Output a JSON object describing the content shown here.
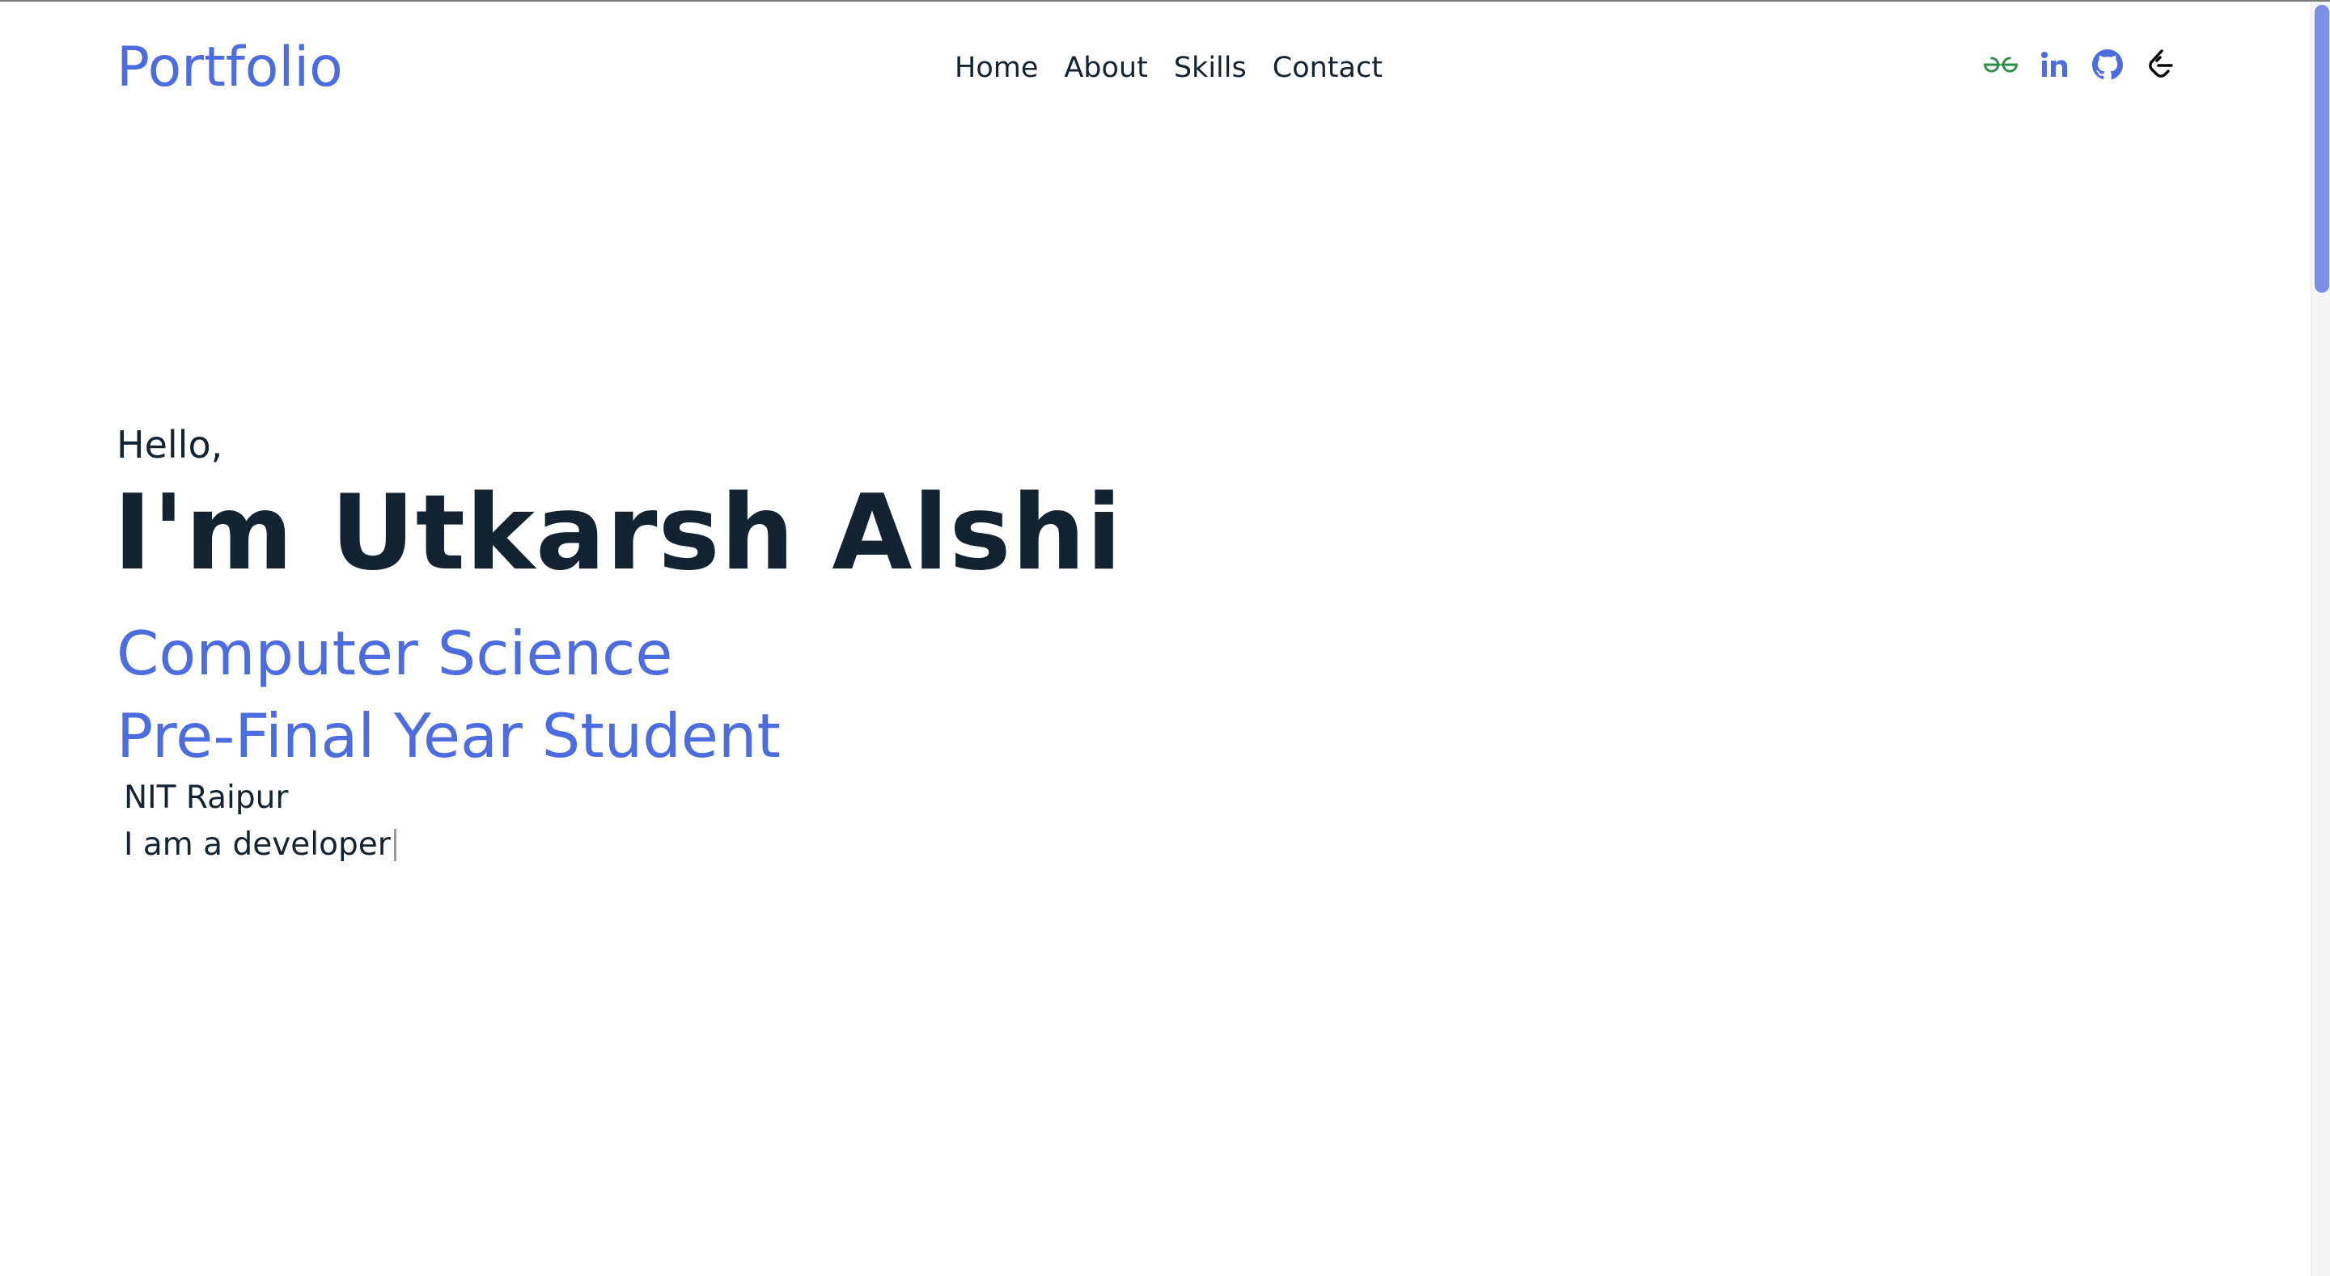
{
  "header": {
    "logo": "Portfolio",
    "nav": [
      {
        "label": "Home"
      },
      {
        "label": "About"
      },
      {
        "label": "Skills"
      },
      {
        "label": "Contact"
      }
    ],
    "socials": [
      {
        "icon": "geeksforgeeks-icon",
        "color": "#2f8d46"
      },
      {
        "icon": "linkedin-icon",
        "color": "#4c6ce0"
      },
      {
        "icon": "github-icon",
        "color": "#4c6ce0"
      },
      {
        "icon": "leetcode-icon",
        "color": "#000000"
      }
    ]
  },
  "hero": {
    "greeting": "Hello,",
    "name": "I'm Utkarsh Alshi",
    "role_line_1": "Computer Science",
    "role_line_2": "Pre-Final Year Student",
    "college": "NIT Raipur",
    "typed_text": "I am a developer"
  },
  "colors": {
    "accent": "#4c6ce0",
    "text": "#142331",
    "scroll_thumb": "#7b8fe8"
  }
}
